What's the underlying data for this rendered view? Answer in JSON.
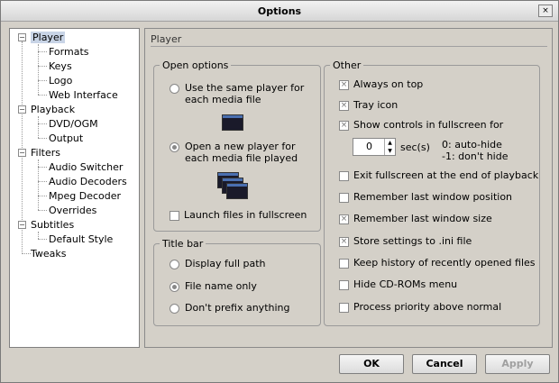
{
  "window": {
    "title": "Options",
    "close_glyph": "×"
  },
  "tree": {
    "items": [
      {
        "label": "Player",
        "expander": "−"
      },
      {
        "label": "Formats"
      },
      {
        "label": "Keys"
      },
      {
        "label": "Logo"
      },
      {
        "label": "Web Interface"
      },
      {
        "label": "Playback",
        "expander": "−"
      },
      {
        "label": "DVD/OGM"
      },
      {
        "label": "Output"
      },
      {
        "label": "Filters",
        "expander": "−"
      },
      {
        "label": "Audio Switcher"
      },
      {
        "label": "Audio Decoders"
      },
      {
        "label": "Mpeg Decoder"
      },
      {
        "label": "Overrides"
      },
      {
        "label": "Subtitles",
        "expander": "−"
      },
      {
        "label": "Default Style"
      },
      {
        "label": "Tweaks"
      }
    ],
    "selected": "Player"
  },
  "panel": {
    "header": "Player",
    "open_options": {
      "title": "Open options",
      "same_player": {
        "line1": "Use the same player for",
        "line2": "each media file",
        "checked": false
      },
      "new_player": {
        "line1": "Open a new player for",
        "line2": "each media file played",
        "checked": true
      },
      "launch_fullscreen": {
        "label": "Launch files in fullscreen",
        "checked": false
      }
    },
    "title_bar": {
      "title": "Title bar",
      "options": [
        {
          "label": "Display full path",
          "checked": false
        },
        {
          "label": "File name only",
          "checked": true
        },
        {
          "label": "Don't prefix anything",
          "checked": false
        }
      ]
    },
    "other": {
      "title": "Other",
      "always_on_top": {
        "label": "Always on top",
        "checked": true
      },
      "tray_icon": {
        "label": "Tray icon",
        "checked": true
      },
      "show_controls": {
        "label": "Show controls in fullscreen for",
        "checked": true
      },
      "spinner": {
        "value": "0",
        "unit": "sec(s)",
        "hint1": "0: auto-hide",
        "hint2": "-1: don't hide",
        "up": "▲",
        "down": "▼"
      },
      "exit_fullscreen": {
        "label": "Exit fullscreen at the end of playback",
        "checked": false
      },
      "remember_position": {
        "label": "Remember last window position",
        "checked": false
      },
      "remember_size": {
        "label": "Remember last window size",
        "checked": true
      },
      "store_ini": {
        "label": "Store settings to .ini file",
        "checked": true
      },
      "keep_history": {
        "label": "Keep history of recently opened files",
        "checked": false
      },
      "hide_cdrom": {
        "label": "Hide CD-ROMs menu",
        "checked": false
      },
      "priority": {
        "label": "Process priority above normal",
        "checked": false
      }
    }
  },
  "buttons": {
    "ok": "OK",
    "cancel": "Cancel",
    "apply": "Apply"
  },
  "check_glyph": "×"
}
